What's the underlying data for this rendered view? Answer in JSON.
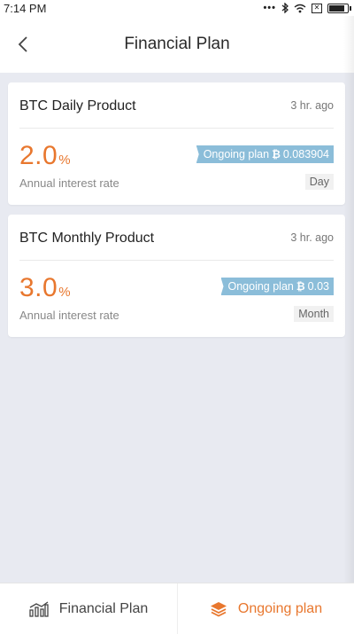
{
  "status_bar": {
    "time": "7:14 PM",
    "icons": [
      "more-dots-icon",
      "bluetooth-icon",
      "wifi-icon",
      "no-sim-icon",
      "battery-icon"
    ]
  },
  "header": {
    "title": "Financial Plan",
    "back_icon": "chevron-left-icon"
  },
  "products": [
    {
      "title": "BTC Daily Product",
      "time": "3 hr. ago",
      "rate": "2.0",
      "rate_unit": "%",
      "rate_label": "Annual interest rate",
      "ongoing_label": "Ongoing plan",
      "btc_symbol": "₿",
      "ongoing_amount": "0.083904",
      "period": "Day"
    },
    {
      "title": "BTC Monthly Product",
      "time": "3 hr. ago",
      "rate": "3.0",
      "rate_unit": "%",
      "rate_label": "Annual interest rate",
      "ongoing_label": "Ongoing plan",
      "btc_symbol": "₿",
      "ongoing_amount": "0.03",
      "period": "Month"
    }
  ],
  "bottom_nav": {
    "items": [
      {
        "label": "Financial Plan",
        "icon": "bar-chart-icon"
      },
      {
        "label": "Ongoing plan",
        "icon": "layers-icon"
      }
    ]
  },
  "colors": {
    "accent": "#e8772e",
    "tag_blue": "#8bbdd9",
    "background": "#e8eaf1"
  }
}
